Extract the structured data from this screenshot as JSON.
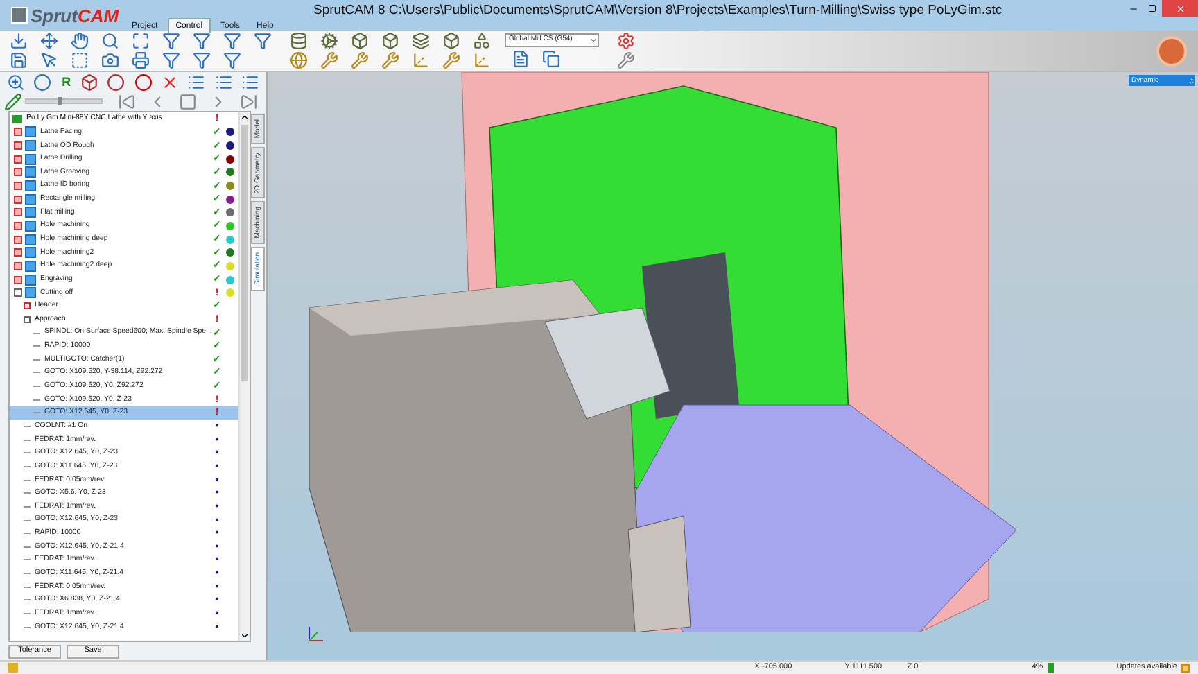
{
  "window": {
    "title": "SprutCAM 8   C:\\Users\\Public\\Documents\\SprutCAM\\Version 8\\Projects\\Examples\\Turn-Milling\\Swiss type PoLyGim.stc"
  },
  "logo": {
    "part1": "Sprut",
    "part2": "CAM"
  },
  "menu_tabs": [
    {
      "label": "Project",
      "selected": false
    },
    {
      "label": "Control",
      "selected": true
    },
    {
      "label": "Tools",
      "selected": false
    },
    {
      "label": "Help",
      "selected": false
    }
  ],
  "toolbar": {
    "cs_dropdown": "Global Mill CS (G54)"
  },
  "panel_toolbar": {
    "r_label": "R",
    "slider": {
      "level": 0.45
    }
  },
  "side_tabs": [
    {
      "label": "Model",
      "selected": false
    },
    {
      "label": "2D Geometry",
      "selected": false
    },
    {
      "label": "Machining",
      "selected": false
    },
    {
      "label": "Simulation",
      "selected": true
    }
  ],
  "tree": {
    "label": "Po Ly Gm Mini-88Y CNC Lathe with Y axis",
    "status": {
      "mark": "!",
      "color": "#e01010"
    },
    "children": [
      {
        "label": "Lathe Facing",
        "kind": "operation",
        "status": {
          "mark": "✓",
          "color": "#22a022"
        },
        "color": "#1a1a80",
        "expanded": false,
        "selected": false
      },
      {
        "label": "Lathe OD Rough",
        "kind": "operation",
        "status": {
          "mark": "✓",
          "color": "#22a022"
        },
        "color": "#1a1a80",
        "expanded": false,
        "selected": false
      },
      {
        "label": "Lathe Drilling",
        "kind": "operation",
        "status": {
          "mark": "✓",
          "color": "#22a022"
        },
        "color": "#8b0000",
        "expanded": false,
        "selected": false
      },
      {
        "label": "Lathe Grooving",
        "kind": "operation",
        "status": {
          "mark": "✓",
          "color": "#22a022"
        },
        "color": "#1e7a1e",
        "expanded": false,
        "selected": false
      },
      {
        "label": "Lathe ID boring",
        "kind": "operation",
        "status": {
          "mark": "✓",
          "color": "#22a022"
        },
        "color": "#8b8b1a",
        "expanded": false,
        "selected": false
      },
      {
        "label": "Rectangle milling",
        "kind": "operation",
        "status": {
          "mark": "✓",
          "color": "#22a022"
        },
        "color": "#8b1a8b",
        "expanded": false,
        "selected": false
      },
      {
        "label": "Flat milling",
        "kind": "operation",
        "status": {
          "mark": "✓",
          "color": "#22a022"
        },
        "color": "#6e6e6e",
        "expanded": false,
        "selected": false
      },
      {
        "label": "Hole machining",
        "kind": "operation",
        "status": {
          "mark": "✓",
          "color": "#22a022"
        },
        "color": "#22cc22",
        "expanded": false,
        "selected": false
      },
      {
        "label": "Hole machining deep",
        "kind": "operation",
        "status": {
          "mark": "✓",
          "color": "#22a022"
        },
        "color": "#22cccc",
        "expanded": false,
        "selected": false
      },
      {
        "label": "Hole machining2",
        "kind": "operation",
        "status": {
          "mark": "✓",
          "color": "#22a022"
        },
        "color": "#1e7a1e",
        "expanded": false,
        "selected": false
      },
      {
        "label": "Hole machining2 deep",
        "kind": "operation",
        "status": {
          "mark": "✓",
          "color": "#22a022"
        },
        "color": "#dddd22",
        "expanded": false,
        "selected": false
      },
      {
        "label": "Engraving",
        "kind": "operation",
        "status": {
          "mark": "✓",
          "color": "#22a022"
        },
        "color": "#22cccc",
        "expanded": false,
        "selected": false
      },
      {
        "label": "Cutting off",
        "kind": "operation",
        "status": {
          "mark": "!",
          "color": "#e01010"
        },
        "color": "#dddd22",
        "expanded": true,
        "selected": false,
        "children": [
          {
            "label": "Header",
            "kind": "group",
            "status": {
              "mark": "✓",
              "color": "#22a022"
            },
            "expanded": false,
            "selected": false
          },
          {
            "label": "Approach",
            "kind": "group",
            "status": {
              "mark": "!",
              "color": "#e01010"
            },
            "expanded": true,
            "selected": false,
            "children": [
              {
                "label": "SPINDL: On Surface Speed600; Max. Spindle Spe...",
                "kind": "command",
                "status": {
                  "mark": "✓",
                  "color": "#22a022"
                },
                "selected": false
              },
              {
                "label": "RAPID: 10000",
                "kind": "command",
                "status": {
                  "mark": "✓",
                  "color": "#22a022"
                },
                "selected": false
              },
              {
                "label": "MULTIGOTO: Catcher(1)",
                "kind": "command",
                "status": {
                  "mark": "✓",
                  "color": "#22a022"
                },
                "selected": false
              },
              {
                "label": "GOTO: X109.520, Y-38.114, Z92.272",
                "kind": "command",
                "status": {
                  "mark": "✓",
                  "color": "#22a022"
                },
                "selected": false
              },
              {
                "label": "GOTO: X109.520, Y0, Z92.272",
                "kind": "command",
                "status": {
                  "mark": "✓",
                  "color": "#22a022"
                },
                "selected": false
              },
              {
                "label": "GOTO: X109.520, Y0, Z-23",
                "kind": "command",
                "status": {
                  "mark": "!",
                  "color": "#e01010"
                },
                "selected": false
              },
              {
                "label": "GOTO: X12.645, Y0, Z-23",
                "kind": "command",
                "status": {
                  "mark": "!",
                  "color": "#e01010"
                },
                "selected": true
              }
            ]
          },
          {
            "label": "COOLNT: #1 On",
            "kind": "command",
            "status": {
              "mark": "•",
              "color": "#1a1aa0"
            },
            "selected": false
          },
          {
            "label": "FEDRAT: 1mm/rev.",
            "kind": "command",
            "status": {
              "mark": "•",
              "color": "#1a1aa0"
            },
            "selected": false
          },
          {
            "label": "GOTO: X12.645, Y0, Z-23",
            "kind": "command",
            "status": {
              "mark": "•",
              "color": "#1a1aa0"
            },
            "selected": false
          },
          {
            "label": "GOTO: X11.645, Y0, Z-23",
            "kind": "command",
            "status": {
              "mark": "•",
              "color": "#1a1aa0"
            },
            "selected": false
          },
          {
            "label": "FEDRAT: 0.05mm/rev.",
            "kind": "command",
            "status": {
              "mark": "•",
              "color": "#1a1aa0"
            },
            "selected": false
          },
          {
            "label": "GOTO: X5.6, Y0, Z-23",
            "kind": "command",
            "status": {
              "mark": "•",
              "color": "#1a1aa0"
            },
            "selected": false
          },
          {
            "label": "FEDRAT: 1mm/rev.",
            "kind": "command",
            "status": {
              "mark": "•",
              "color": "#1a1aa0"
            },
            "selected": false
          },
          {
            "label": "GOTO: X12.645, Y0, Z-23",
            "kind": "command",
            "status": {
              "mark": "•",
              "color": "#1a1aa0"
            },
            "selected": false
          },
          {
            "label": "RAPID: 10000",
            "kind": "command",
            "status": {
              "mark": "•",
              "color": "#1a1aa0"
            },
            "selected": false
          },
          {
            "label": "GOTO: X12.645, Y0, Z-21.4",
            "kind": "command",
            "status": {
              "mark": "•",
              "color": "#1a1aa0"
            },
            "selected": false
          },
          {
            "label": "FEDRAT: 1mm/rev.",
            "kind": "command",
            "status": {
              "mark": "•",
              "color": "#1a1aa0"
            },
            "selected": false
          },
          {
            "label": "GOTO: X11.645, Y0, Z-21.4",
            "kind": "command",
            "status": {
              "mark": "•",
              "color": "#1a1aa0"
            },
            "selected": false
          },
          {
            "label": "FEDRAT: 0.05mm/rev.",
            "kind": "command",
            "status": {
              "mark": "•",
              "color": "#1a1aa0"
            },
            "selected": false
          },
          {
            "label": "GOTO: X6.838, Y0, Z-21.4",
            "kind": "command",
            "status": {
              "mark": "•",
              "color": "#1a1aa0"
            },
            "selected": false
          },
          {
            "label": "FEDRAT: 1mm/rev.",
            "kind": "command",
            "status": {
              "mark": "•",
              "color": "#1a1aa0"
            },
            "selected": false
          },
          {
            "label": "GOTO: X12.645, Y0, Z-21.4",
            "kind": "command",
            "status": {
              "mark": "•",
              "color": "#1a1aa0"
            },
            "selected": false
          }
        ]
      }
    ]
  },
  "panel_buttons": [
    "Tolerance",
    "Save"
  ],
  "viewport": {
    "view_mode": "Dynamic"
  },
  "status_bar": {
    "x": "X -705.000",
    "y": "Y 1111.500",
    "z": "Z 0",
    "progress_text": "4%",
    "updates": "Updates available"
  }
}
